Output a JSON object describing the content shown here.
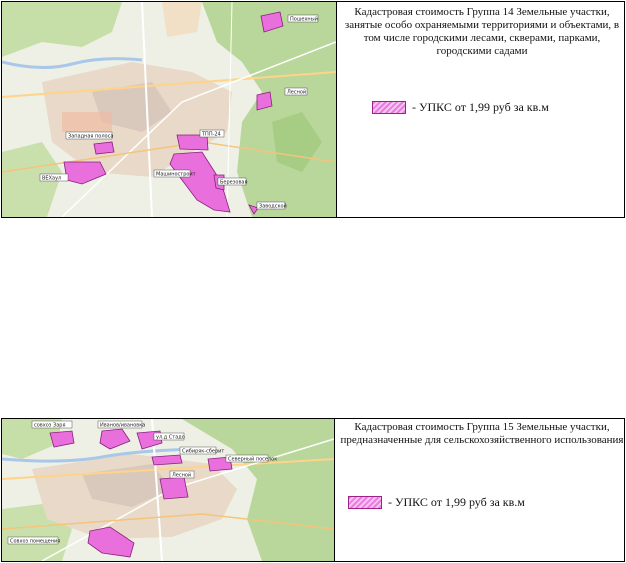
{
  "colors": {
    "zone_fill": "#e86fdc",
    "zone_stroke": "#8b1f7e",
    "forest": "#b9d79a",
    "urban": "#e8d9c8",
    "industrial": "#d9c9bd",
    "water": "#a9c7e8"
  },
  "map1": {
    "title": "Кадастровая стоимость Группа 14 Земельные участки, занятые особо охраняемыми территориями и объектами, в том числе городскими лесами, скверами, парками, городскими садами",
    "legend_label": "- УПКС от 1,99 руб за кв.м",
    "places": {
      "poshekhonsky": "Пошехный",
      "lesnoy": "Лесной",
      "zapadnaya": "Западная полоса",
      "vekhaul": "ВЕХаул",
      "tpp": "ТПП-24",
      "mashinostroy": "Машиностроит",
      "berezovaya": "Березовая",
      "zavodskoy": "Заводской"
    }
  },
  "map2": {
    "title": "Кадастровая стоимость Группа 15 Земельные участки, предназначенные для сельскохозяйственного использования",
    "legend_label": "- УПКС от 1,99 руб за кв.м",
    "places": {
      "zaria": "совхоз Заря",
      "ivanovka": "Иванов/ивановка",
      "stadion": "ул.д Стадо",
      "subbotino": "Сибиряк-сберит",
      "lesnaya": "Лесной",
      "severnaya": "Северный поселок",
      "sovkhoz": "Совхоз помещения"
    }
  }
}
